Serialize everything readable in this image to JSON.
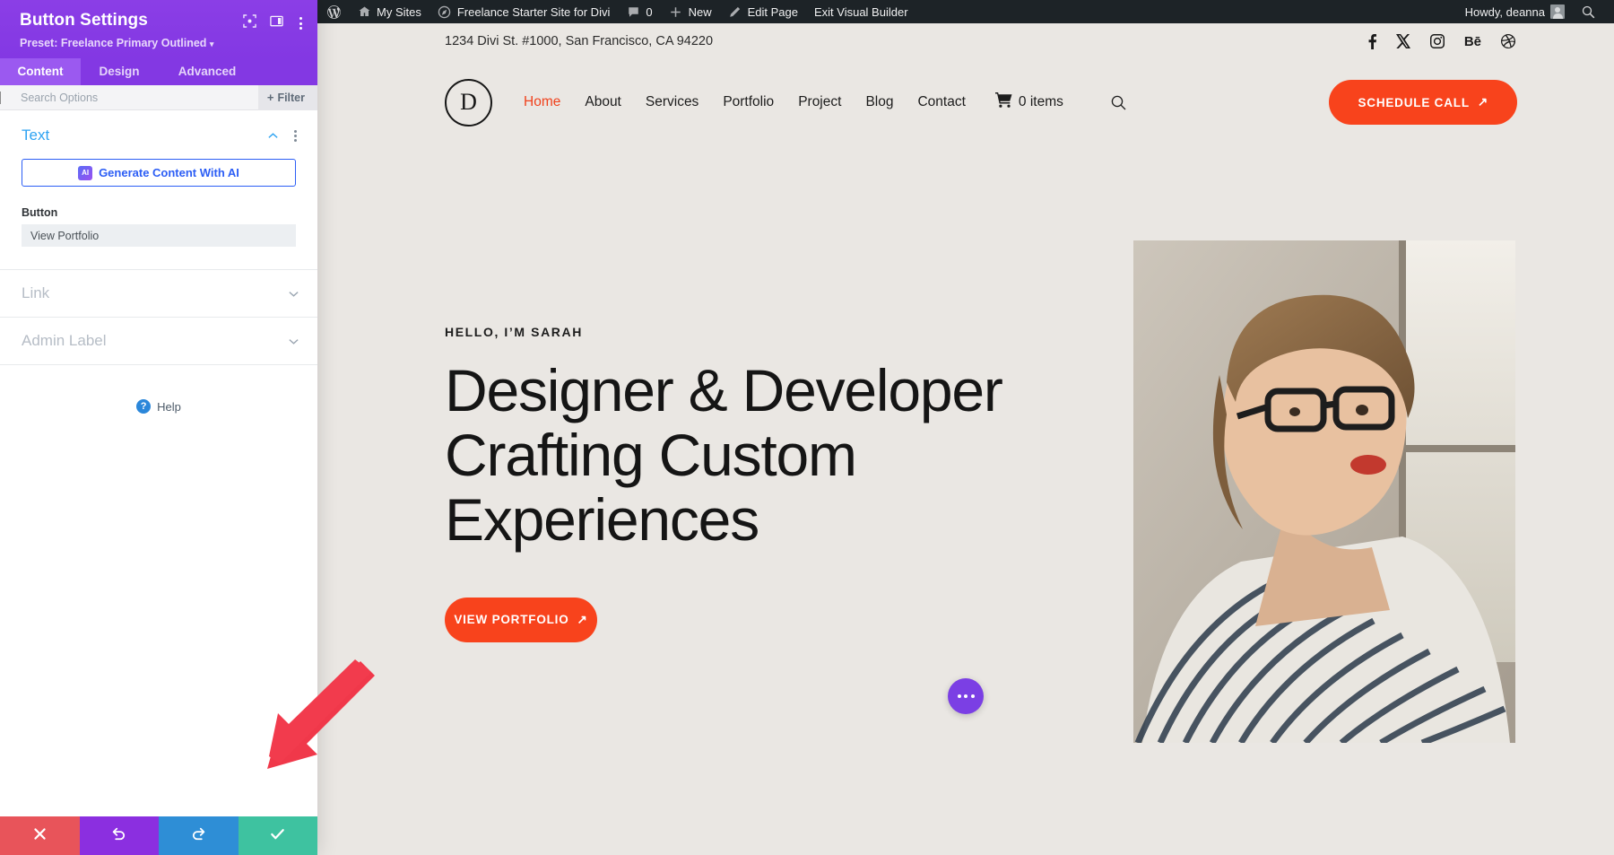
{
  "adminbar": {
    "left_items": [
      {
        "icon": "wordpress-icon",
        "label": ""
      },
      {
        "icon": "sites-icon",
        "label": "My Sites"
      },
      {
        "icon": "dashboard-icon",
        "label": "Freelance Starter Site for Divi"
      },
      {
        "icon": "comment-icon",
        "label": "0"
      },
      {
        "icon": "plus-icon",
        "label": "New"
      },
      {
        "icon": "pencil-icon",
        "label": "Edit Page"
      },
      {
        "icon": "",
        "label": "Exit Visual Builder"
      }
    ],
    "howdy": "Howdy, deanna",
    "search_icon": "search-icon"
  },
  "panel": {
    "title": "Button Settings",
    "preset": "Preset: Freelance Primary Outlined",
    "preset_caret": "▾",
    "tabs": [
      {
        "label": "Content",
        "active": true
      },
      {
        "label": "Design",
        "active": false
      },
      {
        "label": "Advanced",
        "active": false
      }
    ],
    "search_placeholder": "Search Options",
    "search_value": "",
    "filter_label": "Filter",
    "filter_plus": "+",
    "sections": {
      "text": {
        "title": "Text",
        "ai_button": "Generate Content With AI",
        "ai_badge": "AI",
        "field_label": "Button",
        "field_value": "View Portfolio"
      },
      "link": {
        "title": "Link"
      },
      "admin_label": {
        "title": "Admin Label"
      }
    },
    "help_label": "Help",
    "help_icon_glyph": "?",
    "footer": [
      {
        "name": "discard",
        "icon": "close-icon",
        "color": "#e8545a"
      },
      {
        "name": "undo",
        "icon": "undo-icon",
        "color": "#8b2fe0"
      },
      {
        "name": "redo",
        "icon": "redo-icon",
        "color": "#2e8ed6"
      },
      {
        "name": "save",
        "icon": "check-icon",
        "color": "#3ec2a0"
      }
    ]
  },
  "site": {
    "address": "1234 Divi St. #1000, San Francisco, CA 94220",
    "socials": [
      {
        "name": "facebook-icon",
        "glyph": "f"
      },
      {
        "name": "x-twitter-icon",
        "glyph": "𝕏"
      },
      {
        "name": "instagram-icon",
        "glyph": ""
      },
      {
        "name": "behance-icon",
        "glyph": "Bē"
      },
      {
        "name": "dribbble-icon",
        "glyph": ""
      }
    ],
    "logo_letter": "D",
    "nav": [
      {
        "label": "Home",
        "active": true
      },
      {
        "label": "About",
        "active": false
      },
      {
        "label": "Services",
        "active": false
      },
      {
        "label": "Portfolio",
        "active": false
      },
      {
        "label": "Project",
        "active": false
      },
      {
        "label": "Blog",
        "active": false
      },
      {
        "label": "Contact",
        "active": false
      }
    ],
    "cart_label": "0 items",
    "cta_label": "SCHEDULE CALL",
    "cta_arrow": "↗",
    "hero": {
      "eyebrow": "HELLO, I’M SARAH",
      "title_line1": "Designer & Developer",
      "title_line2": "Crafting Custom",
      "title_line3": "Experiences",
      "button_label": "VIEW PORTFOLIO",
      "button_arrow": "↗"
    },
    "accent_color": "#f8431c"
  }
}
